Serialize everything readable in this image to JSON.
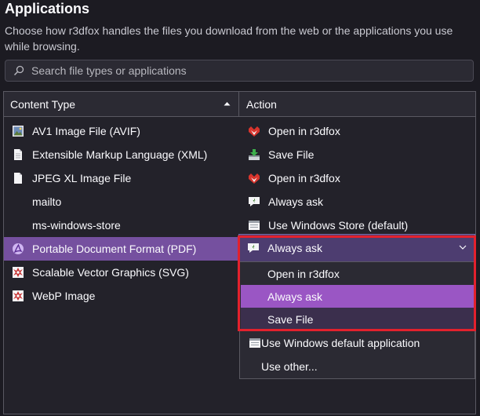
{
  "header": {
    "title": "Applications",
    "description": "Choose how r3dfox handles the files you download from the web or the applications you use while browsing."
  },
  "search": {
    "placeholder": "Search file types or applications"
  },
  "table": {
    "col_type": "Content Type",
    "col_action": "Action",
    "rows": [
      {
        "type": "AV1 Image File (AVIF)",
        "type_icon": "image-file-icon",
        "action": "Open in r3dfox",
        "action_icon": "r3dfox-icon"
      },
      {
        "type": "Extensible Markup Language (XML)",
        "type_icon": "document-icon",
        "action": "Save File",
        "action_icon": "save-file-icon"
      },
      {
        "type": "JPEG XL Image File",
        "type_icon": "document-icon",
        "action": "Open in r3dfox",
        "action_icon": "r3dfox-icon"
      },
      {
        "type": "mailto",
        "type_icon": "",
        "action": "Always ask",
        "action_icon": "ask-icon"
      },
      {
        "type": "ms-windows-store",
        "type_icon": "",
        "action": "Use Windows Store (default)",
        "action_icon": "windows-app-icon"
      },
      {
        "type": "Portable Document Format (PDF)",
        "type_icon": "pdf-icon",
        "action": "Always ask",
        "action_icon": "ask-icon",
        "selected": true
      },
      {
        "type": "Scalable Vector Graphics (SVG)",
        "type_icon": "svg-file-icon",
        "action": "",
        "action_icon": ""
      },
      {
        "type": "WebP Image",
        "type_icon": "svg-file-icon",
        "action": "",
        "action_icon": ""
      }
    ]
  },
  "dropdown": {
    "selected": "Always ask",
    "options": [
      "Open in r3dfox",
      "Always ask",
      "Save File",
      "Use Windows default application",
      "Use other..."
    ]
  },
  "colors": {
    "background": "#1c1b22",
    "selected_row": "#75509f",
    "menu_highlight": "#9a56c4",
    "focus_outline": "#e3212d"
  }
}
